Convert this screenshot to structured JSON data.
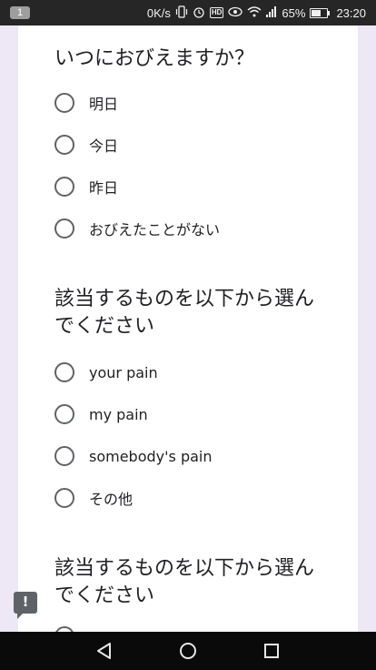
{
  "status_bar": {
    "notification_count": "1",
    "network_speed": "0K/s",
    "hd_label": "HD",
    "battery_percent": "65%",
    "time": "23:20"
  },
  "form": {
    "questions": [
      {
        "title": "いつにおびえますか？",
        "options": [
          "明日",
          "今日",
          "昨日",
          "おびえたことがない"
        ]
      },
      {
        "title": "該当するものを以下から選んでください",
        "options": [
          "your pain",
          "my pain",
          "somebody's pain",
          "その他"
        ]
      },
      {
        "title": "該当するものを以下から選んでください",
        "options": []
      }
    ]
  },
  "colors": {
    "page_background": "#ede7f6",
    "radio_border": "#5f6368",
    "text": "#202124"
  },
  "icons": {
    "feedback": "feedback-icon",
    "nav_back": "back-triangle-icon",
    "nav_home": "home-circle-icon",
    "nav_recents": "recents-square-icon"
  }
}
